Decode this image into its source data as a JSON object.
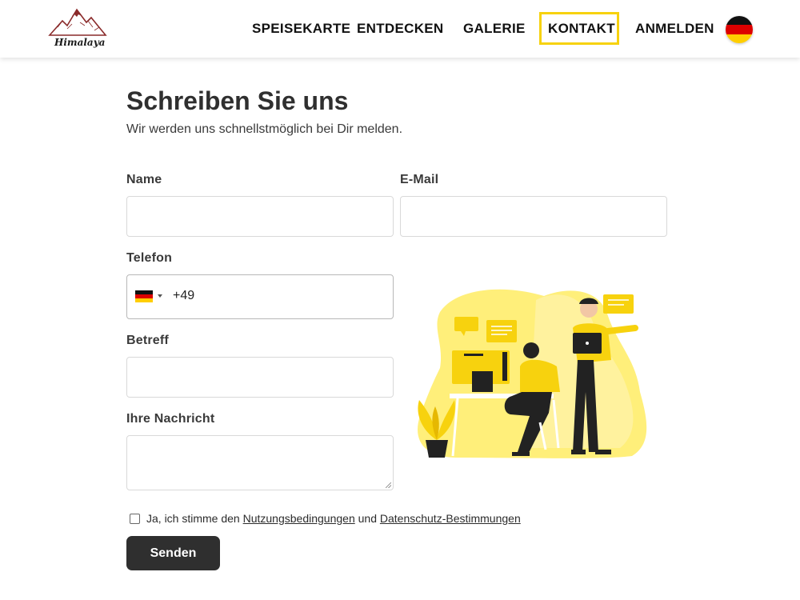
{
  "brand": {
    "logo_text": "Himalaya"
  },
  "nav": {
    "items": [
      {
        "label": "SPEISEKARTE"
      },
      {
        "label": "ENTDECKEN"
      },
      {
        "label": "GALERIE"
      },
      {
        "label": "KONTAKT",
        "active": true
      },
      {
        "label": "ANMELDEN"
      }
    ],
    "language_flag": "de-flag-icon",
    "active_color": "#f7d20e"
  },
  "page": {
    "title": "Schreiben Sie uns",
    "subtitle": "Wir werden uns schnellstmöglich bei Dir melden."
  },
  "form": {
    "name_label": "Name",
    "name_value": "",
    "email_label": "E-Mail",
    "email_value": "",
    "phone_label": "Telefon",
    "phone_prefix": "+49",
    "phone_value": "",
    "subject_label": "Betreff",
    "subject_value": "",
    "message_label": "Ihre Nachricht",
    "message_value": "",
    "consent_prefix": "Ja, ich stimme den",
    "consent_terms_link": "Nutzungsbedingungen",
    "consent_and": "und",
    "consent_privacy_link": "Datenschutz-Bestimmungen",
    "consent_checked": false,
    "submit_label": "Senden"
  },
  "colors": {
    "accent": "#f7d20e",
    "dark": "#2f2f2f",
    "illustration_yellow": "#ffe95a"
  }
}
